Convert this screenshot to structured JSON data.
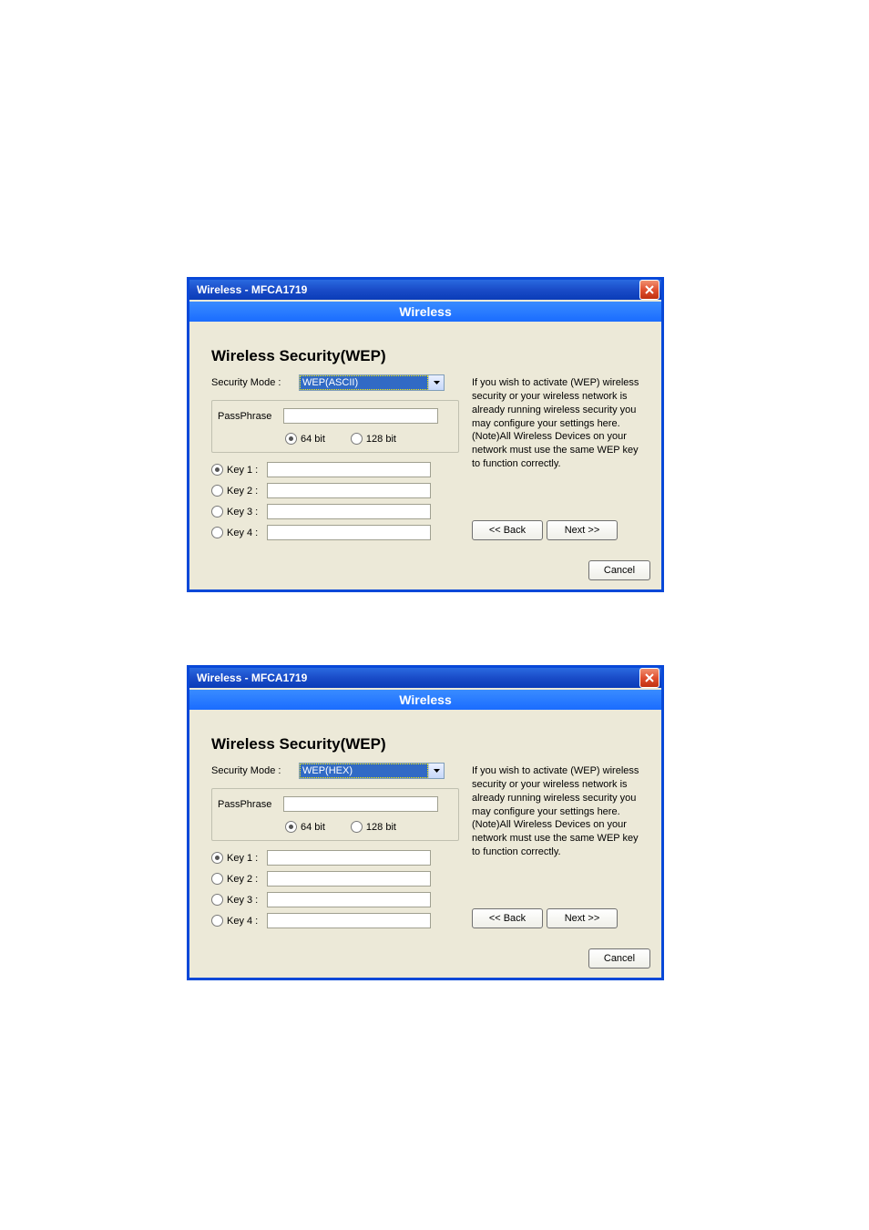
{
  "dialogs": [
    {
      "id": "dlg1",
      "title": "Wireless - MFCA1719",
      "header": "Wireless",
      "section_title": "Wireless Security(WEP)",
      "security_mode_label": "Security Mode :",
      "security_mode_value": "WEP(ASCII)",
      "passphrase_label": "PassPhrase",
      "passphrase_value": "",
      "bit64_label": "64 bit",
      "bit128_label": "128 bit",
      "bit_selected": "64",
      "keys": [
        {
          "label": "Key 1 :",
          "selected": true,
          "value": ""
        },
        {
          "label": "Key 2 :",
          "selected": false,
          "value": ""
        },
        {
          "label": "Key 3 :",
          "selected": false,
          "value": ""
        },
        {
          "label": "Key 4 :",
          "selected": false,
          "value": ""
        }
      ],
      "help_text": "If you wish to activate (WEP) wireless security or your wireless network is already running wireless security you may configure your settings here. (Note)All Wireless Devices on your network must use the same WEP key to function correctly.",
      "back_label": "<< Back",
      "next_label": "Next >>",
      "cancel_label": "Cancel"
    },
    {
      "id": "dlg2",
      "title": "Wireless - MFCA1719",
      "header": "Wireless",
      "section_title": "Wireless Security(WEP)",
      "security_mode_label": "Security Mode :",
      "security_mode_value": "WEP(HEX)",
      "passphrase_label": "PassPhrase",
      "passphrase_value": "",
      "bit64_label": "64 bit",
      "bit128_label": "128 bit",
      "bit_selected": "64",
      "keys": [
        {
          "label": "Key 1 :",
          "selected": true,
          "value": ""
        },
        {
          "label": "Key 2 :",
          "selected": false,
          "value": ""
        },
        {
          "label": "Key 3 :",
          "selected": false,
          "value": ""
        },
        {
          "label": "Key 4 :",
          "selected": false,
          "value": ""
        }
      ],
      "help_text": "If you wish to activate (WEP) wireless security or your wireless network is already running wireless security you may configure your settings here. (Note)All Wireless Devices on your network must use the same WEP key to function correctly.",
      "back_label": "<< Back",
      "next_label": "Next >>",
      "cancel_label": "Cancel"
    }
  ]
}
